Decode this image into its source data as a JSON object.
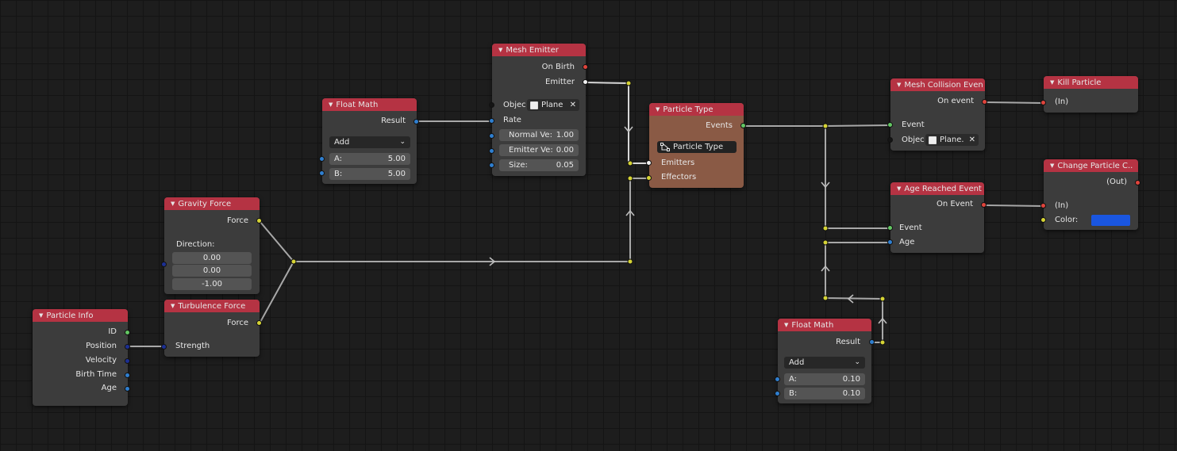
{
  "colors": {
    "yellow": "#d6d435",
    "white": "#f2f2f2",
    "red": "#e0443c",
    "green": "#63c763",
    "blue": "#2f7fd0",
    "darkblue": "#1c2f93",
    "black": "#151515",
    "link": "#a8a8a8",
    "header": "#b53343",
    "color_swatch": "#1a56e0"
  },
  "nodes": {
    "particle_info": {
      "title": "Particle Info",
      "outputs": [
        "ID",
        "Position",
        "Velocity",
        "Birth Time",
        "Age"
      ]
    },
    "gravity_force": {
      "title": "Gravity Force",
      "output": "Force",
      "direction_label": "Direction:",
      "direction": [
        "0.00",
        "0.00",
        "-1.00"
      ]
    },
    "turbulence_force": {
      "title": "Turbulence Force",
      "output": "Force",
      "input": "Strength"
    },
    "float_math_1": {
      "title": "Float Math",
      "output": "Result",
      "operation": "Add",
      "a_label": "A:",
      "a_value": "5.00",
      "b_label": "B:",
      "b_value": "5.00"
    },
    "mesh_emitter": {
      "title": "Mesh Emitter",
      "outputs": [
        "On Birth",
        "Emitter"
      ],
      "object_label": "Objec",
      "object_value": "Plane",
      "rate_label": "Rate",
      "normal_label": "Normal Ve:",
      "normal_value": "1.00",
      "emitter_vel_label": "Emitter Ve:",
      "emitter_vel_value": "0.00",
      "size_label": "Size:",
      "size_value": "0.05"
    },
    "particle_type": {
      "title": "Particle Type",
      "output": "Events",
      "name_value": "Particle Type",
      "inputs": [
        "Emitters",
        "Effectors"
      ]
    },
    "mesh_collision": {
      "title": "Mesh Collision Even",
      "output": "On event",
      "input": "Event",
      "object_label": "Objec",
      "object_value": "Plane."
    },
    "kill_particle": {
      "title": "Kill Particle",
      "input": "(In)"
    },
    "change_color": {
      "title": "Change Particle C..",
      "output": "(Out)",
      "input": "(In)",
      "color_label": "Color:"
    },
    "age_reached": {
      "title": "Age Reached Event",
      "output": "On Event",
      "inputs": [
        "Event",
        "Age"
      ]
    },
    "float_math_2": {
      "title": "Float Math",
      "output": "Result",
      "operation": "Add",
      "a_label": "A:",
      "a_value": "0.10",
      "b_label": "B:",
      "b_value": "0.10"
    }
  },
  "icons": {
    "collapse": "triangle-down",
    "dropdown": "chevron-down",
    "object": "object-square",
    "clear": "x",
    "particle_type": "node-tree"
  }
}
